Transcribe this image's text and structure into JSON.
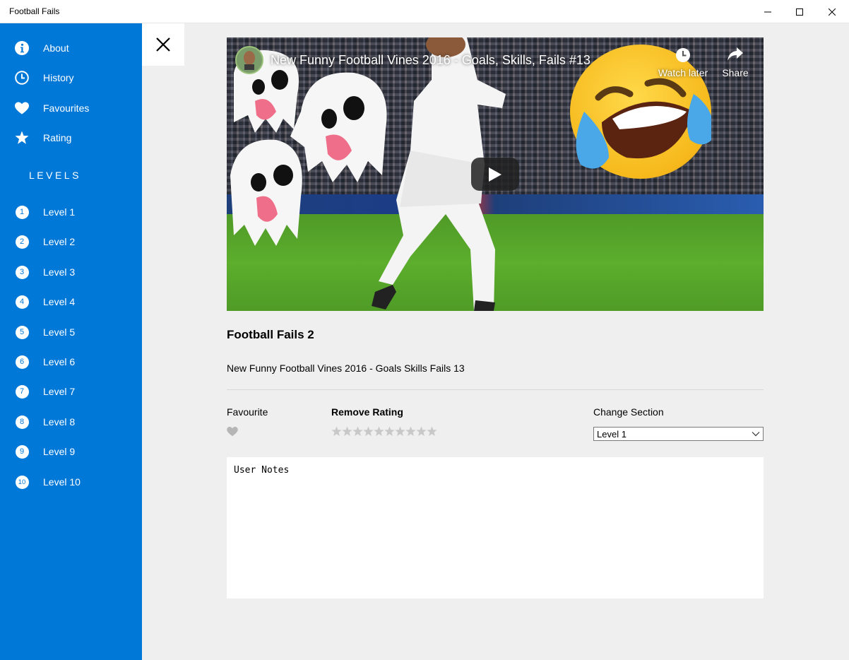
{
  "window": {
    "title": "Football Fails",
    "minimize_icon": "minimize-icon",
    "maximize_icon": "maximize-icon",
    "close_icon": "close-icon"
  },
  "sidebar": {
    "bg_color": "#0078d7",
    "top_items": [
      {
        "label": "About",
        "icon": "info-icon"
      },
      {
        "label": "History",
        "icon": "clock-icon"
      },
      {
        "label": "Favourites",
        "icon": "heart-icon"
      },
      {
        "label": "Rating",
        "icon": "star-icon"
      }
    ],
    "levels_header": "LEVELS",
    "levels": [
      {
        "num": "1",
        "label": "Level 1"
      },
      {
        "num": "2",
        "label": "Level 2"
      },
      {
        "num": "3",
        "label": "Level 3"
      },
      {
        "num": "4",
        "label": "Level 4"
      },
      {
        "num": "5",
        "label": "Level 5"
      },
      {
        "num": "6",
        "label": "Level 6"
      },
      {
        "num": "7",
        "label": "Level 7"
      },
      {
        "num": "8",
        "label": "Level 8"
      },
      {
        "num": "9",
        "label": "Level 9"
      },
      {
        "num": "10",
        "label": "Level 10"
      }
    ]
  },
  "main": {
    "close_icon": "close-icon",
    "video": {
      "youtube_title": "New Funny Football Vines 2016 - Goals, Skills, Fails #13",
      "watch_later": "Watch later",
      "share": "Share",
      "play_icon": "play-icon"
    },
    "title": "Football Fails 2",
    "description": "New Funny Football Vines 2016 - Goals Skills Fails 13",
    "favourite_label": "Favourite",
    "rating_label": "Remove Rating",
    "rating_stars_total": 10,
    "rating_value": 0,
    "change_section_label": "Change Section",
    "section_selected": "Level 1",
    "notes_value": "User Notes"
  }
}
